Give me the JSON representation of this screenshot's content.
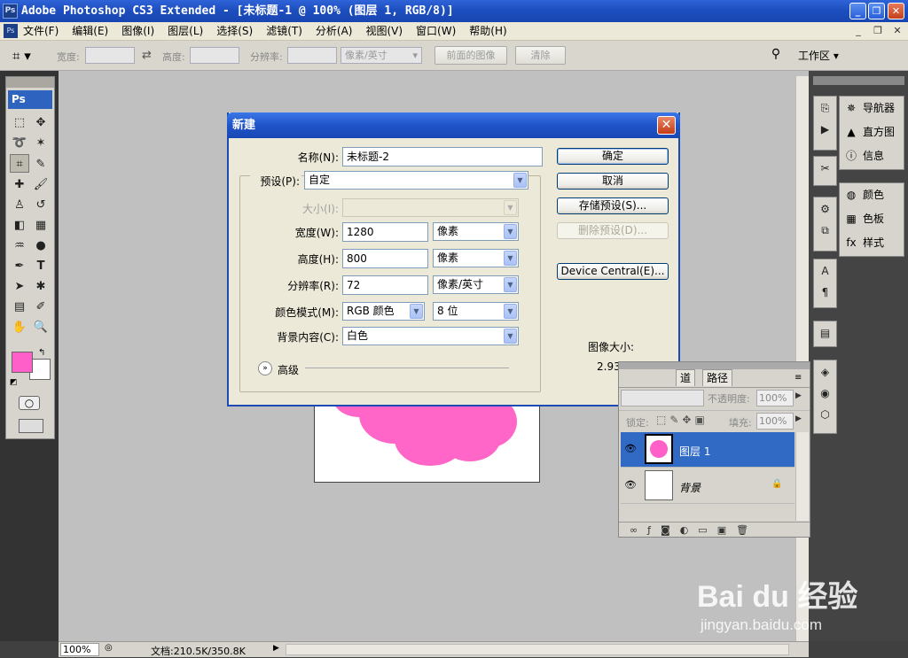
{
  "window": {
    "title": "Adobe Photoshop CS3 Extended - [未标题-1 @ 100% (图层 1, RGB/8)]",
    "app_icon": "Ps"
  },
  "menu": [
    "文件(F)",
    "编辑(E)",
    "图像(I)",
    "图层(L)",
    "选择(S)",
    "滤镜(T)",
    "分析(A)",
    "视图(V)",
    "窗口(W)",
    "帮助(H)"
  ],
  "options_bar": {
    "width_label": "宽度:",
    "height_label": "高度:",
    "resolution_label": "分辨率:",
    "unit_value": "像素/英寸",
    "front_image_button": "前面的图像",
    "clear_button": "清除",
    "workspace_label": "工作区"
  },
  "toolbox": {
    "logo": "Ps",
    "foreground_color": "#ff5fc8",
    "background_color": "#ffffff"
  },
  "dialog": {
    "title": "新建",
    "name_label": "名称(N):",
    "name_value": "未标题-2",
    "preset_label": "预设(P):",
    "preset_value": "自定",
    "size_label": "大小(I):",
    "width_label": "宽度(W):",
    "width_value": "1280",
    "width_unit": "像素",
    "height_label": "高度(H):",
    "height_value": "800",
    "height_unit": "像素",
    "resolution_label": "分辨率(R):",
    "resolution_value": "72",
    "resolution_unit": "像素/英寸",
    "color_mode_label": "颜色模式(M):",
    "color_mode_value": "RGB 颜色",
    "bit_depth_value": "8 位",
    "background_label": "背景内容(C):",
    "background_value": "白色",
    "advanced_label": "高级",
    "ok_button": "确定",
    "cancel_button": "取消",
    "save_preset_button": "存储预设(S)...",
    "delete_preset_button": "删除预设(D)...",
    "device_central_button": "Device Central(E)...",
    "image_size_label": "图像大小:",
    "image_size_value": "2.93M"
  },
  "right_panels": {
    "navigator": "导航器",
    "histogram": "直方图",
    "info": "信息",
    "color": "颜色",
    "swatches": "色板",
    "styles": "样式"
  },
  "layers_panel": {
    "tabs": [
      "道",
      "路径"
    ],
    "opacity_label": "不透明度:",
    "opacity_value": "100%",
    "lock_label": "锁定:",
    "fill_label": "填充:",
    "fill_value": "100%",
    "layers": [
      {
        "name": "图层 1",
        "selected": true
      },
      {
        "name": "背景",
        "selected": false
      }
    ]
  },
  "status_bar": {
    "zoom": "100%",
    "doc_info": "文档:210.5K/350.8K"
  },
  "watermark": {
    "logo_text": "Bai du 经验",
    "url": "jingyan.baidu.com"
  }
}
